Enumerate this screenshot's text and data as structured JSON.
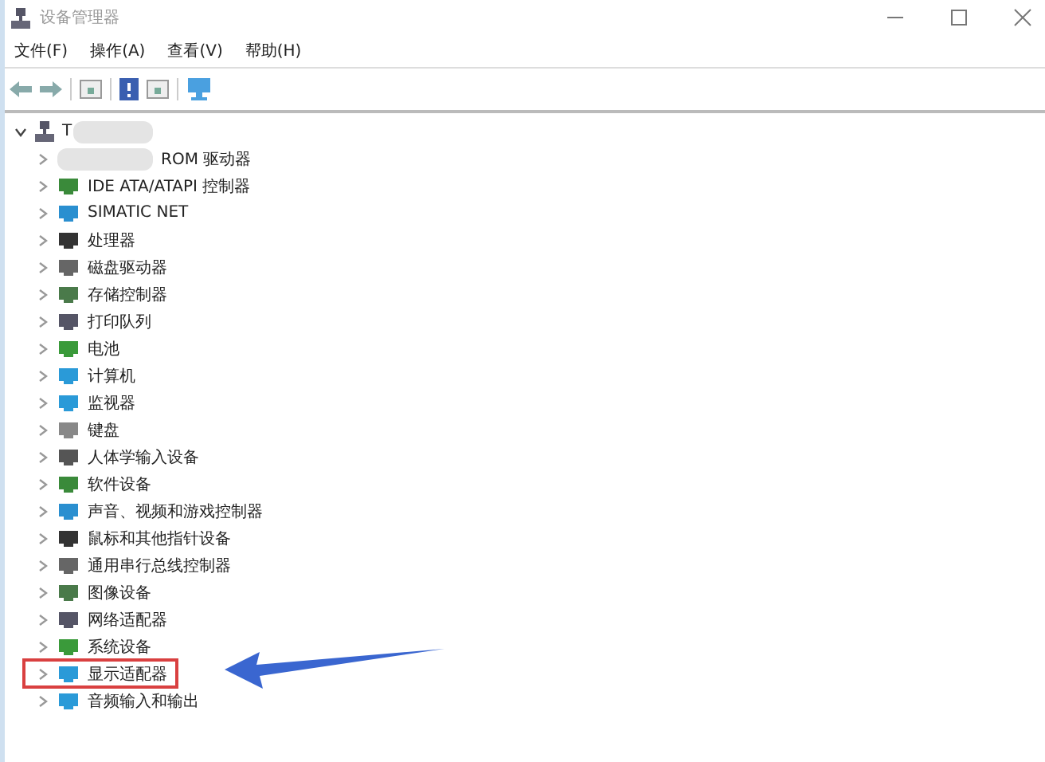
{
  "window": {
    "title": "设备管理器"
  },
  "menu": [
    {
      "label": "文件(F)"
    },
    {
      "label": "操作(A)"
    },
    {
      "label": "查看(V)"
    },
    {
      "label": "帮助(H)"
    }
  ],
  "tree": {
    "label": "T",
    "expanded": true,
    "children": [
      {
        "label": "ROM 驱动器",
        "redacted": true,
        "expanded": false,
        "highlighted": false
      },
      {
        "label": "IDE ATA/ATAPI 控制器",
        "redacted": false,
        "expanded": false,
        "highlighted": false
      },
      {
        "label": "SIMATIC NET",
        "redacted": false,
        "expanded": false,
        "highlighted": false
      },
      {
        "label": "处理器",
        "redacted": false,
        "expanded": false,
        "highlighted": false
      },
      {
        "label": "磁盘驱动器",
        "redacted": false,
        "expanded": false,
        "highlighted": false
      },
      {
        "label": "存储控制器",
        "redacted": false,
        "expanded": false,
        "highlighted": false
      },
      {
        "label": "打印队列",
        "redacted": false,
        "expanded": false,
        "highlighted": false
      },
      {
        "label": "电池",
        "redacted": false,
        "expanded": false,
        "highlighted": false
      },
      {
        "label": "计算机",
        "redacted": false,
        "expanded": false,
        "highlighted": false
      },
      {
        "label": "监视器",
        "redacted": false,
        "expanded": false,
        "highlighted": false
      },
      {
        "label": "键盘",
        "redacted": false,
        "expanded": false,
        "highlighted": false
      },
      {
        "label": "人体学输入设备",
        "redacted": false,
        "expanded": false,
        "highlighted": false
      },
      {
        "label": "软件设备",
        "redacted": false,
        "expanded": false,
        "highlighted": false
      },
      {
        "label": "声音、视频和游戏控制器",
        "redacted": false,
        "expanded": false,
        "highlighted": false
      },
      {
        "label": "鼠标和其他指针设备",
        "redacted": false,
        "expanded": false,
        "highlighted": false
      },
      {
        "label": "通用串行总线控制器",
        "redacted": false,
        "expanded": false,
        "highlighted": false
      },
      {
        "label": "图像设备",
        "redacted": false,
        "expanded": false,
        "highlighted": false
      },
      {
        "label": "网络适配器",
        "redacted": false,
        "expanded": false,
        "highlighted": false
      },
      {
        "label": "系统设备",
        "redacted": false,
        "expanded": false,
        "highlighted": false
      },
      {
        "label": "显示适配器",
        "redacted": false,
        "expanded": false,
        "highlighted": true
      },
      {
        "label": "音频输入和输出",
        "redacted": false,
        "expanded": false,
        "highlighted": false
      }
    ]
  }
}
